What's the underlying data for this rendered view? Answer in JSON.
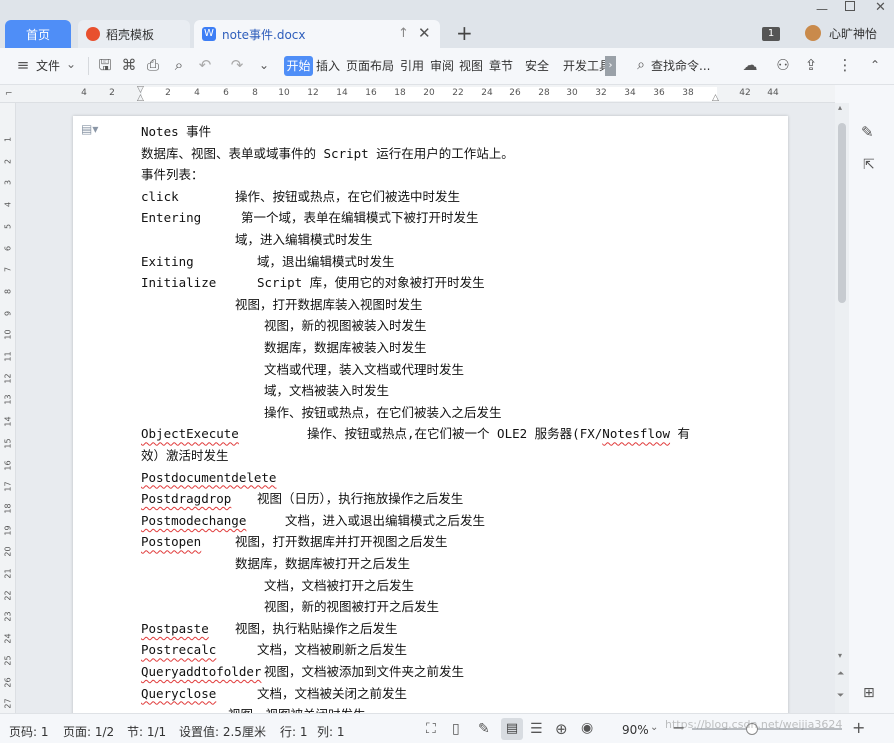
{
  "tabs": {
    "home": "首页",
    "daoke": "稻壳模板",
    "doc": "note事件.docx"
  },
  "title_bar": {
    "badge": "1",
    "user_name": "心旷神怡"
  },
  "menu": {
    "file": "文件",
    "start": "开始",
    "insert": "插入",
    "layout": "页面布局",
    "reference": "引用",
    "review": "审阅",
    "view": "视图",
    "chapter": "章节",
    "security": "安全",
    "dev": "开发工具",
    "search_placeholder": "查找命令..."
  },
  "ruler": {
    "h_ticks": [
      "4",
      "2",
      "2",
      "4",
      "6",
      "8",
      "10",
      "12",
      "14",
      "16",
      "18",
      "20",
      "22",
      "24",
      "26",
      "28",
      "30",
      "32",
      "34",
      "36",
      "38",
      "42",
      "44"
    ],
    "v_ticks": [
      "1",
      "2",
      "3",
      "4",
      "5",
      "6",
      "7",
      "8",
      "9",
      "10",
      "11",
      "12",
      "13",
      "14",
      "15",
      "16",
      "17",
      "18",
      "19",
      "20",
      "21",
      "22",
      "23",
      "24",
      "25",
      "26",
      "27"
    ]
  },
  "document": {
    "lines": [
      {
        "text": "Notes 事件",
        "col": 0
      },
      {
        "text": "数据库、视图、表单或域事件的 Script 运行在用户的工作站上。",
        "col": 0
      },
      {
        "text": "事件列表：",
        "col": 0
      },
      {
        "term": "click",
        "text": "操作、按钮或热点，在它们被选中时发生",
        "col": 0,
        "tcol": 94
      },
      {
        "term": "Entering",
        "text": "第一个域，表单在编辑模式下被打开时发生",
        "col": 0,
        "tcol": 100
      },
      {
        "text": "域，进入编辑模式时发生",
        "col": 94
      },
      {
        "term": "Exiting",
        "text": "域，退出编辑模式时发生",
        "col": 0,
        "tcol": 116
      },
      {
        "term": "Initialize",
        "text": "Script 库，使用它的对象被打开时发生",
        "col": 0,
        "tcol": 116
      },
      {
        "text": "视图，打开数据库装入视图时发生",
        "col": 94
      },
      {
        "text": "视图，新的视图被装入时发生",
        "col": 123
      },
      {
        "text": "数据库，数据库被装入时发生",
        "col": 123
      },
      {
        "text": "文档或代理，装入文档或代理时发生",
        "col": 123
      },
      {
        "text": "域，文档被装入时发生",
        "col": 123
      },
      {
        "text": "操作、按钮或热点，在它们被装入之后发生",
        "col": 123
      },
      {
        "term": "ObjectExecute",
        "text": "操作、按钮或热点,在它们被一个 OLE2 服务器(FX/Notesflow 有",
        "col": 0,
        "tcol": 166,
        "sq": true,
        "sq2": "Notesflow"
      },
      {
        "text": "效）激活时发生",
        "col": 0
      },
      {
        "term": "Postdocumentdelete",
        "text": "",
        "col": 0,
        "sq": true
      },
      {
        "term": "Postdragdrop",
        "text": "视图（日历），执行拖放操作之后发生",
        "col": 0,
        "tcol": 116,
        "sq": true
      },
      {
        "term": "Postmodechange",
        "text": "文档，进入或退出编辑模式之后发生",
        "col": 0,
        "tcol": 144,
        "sq": true
      },
      {
        "term": "Postopen",
        "text": "视图，打开数据库并打开视图之后发生",
        "col": 0,
        "tcol": 94,
        "sq": true
      },
      {
        "text": "数据库，数据库被打开之后发生",
        "col": 94
      },
      {
        "text": "文档，文档被打开之后发生",
        "col": 123
      },
      {
        "text": "视图，新的视图被打开之后发生",
        "col": 123
      },
      {
        "term": "Postpaste",
        "text": "视图，执行粘贴操作之后发生",
        "col": 0,
        "tcol": 94,
        "sq": true
      },
      {
        "term": "Postrecalc",
        "text": "文档，文档被刷新之后发生",
        "col": 0,
        "tcol": 116,
        "sq": true
      },
      {
        "term": "Queryaddtofolder",
        "text": "视图，文档被添加到文件夹之前发生",
        "col": 0,
        "tcol": 123,
        "sq": true
      },
      {
        "term": "Queryclose",
        "text": "文档，文档被关闭之前发生",
        "col": 0,
        "tcol": 116,
        "sq": true
      },
      {
        "text": "视图，视图被关闭时发生",
        "col": 87
      }
    ]
  },
  "status": {
    "page_no": "页码: 1",
    "pages": "页面: 1/2",
    "section": "节: 1/1",
    "setting": "设置值: 2.5厘米",
    "row": "行: 1",
    "col": "列: 1",
    "zoom": "90%",
    "watermark": "https://blog.csdn.net/weijia3624"
  },
  "colors": {
    "accent": "#4f8ef7",
    "start_tab": "#4f8ef7",
    "squiggle": "#e03a3a"
  }
}
